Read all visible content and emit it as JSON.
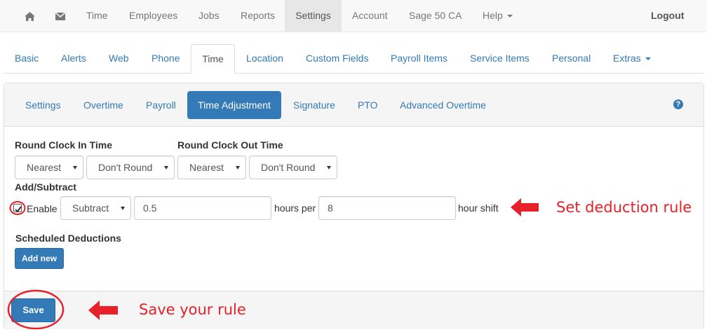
{
  "topnav": {
    "home_icon": "home-icon",
    "mail_icon": "envelope-icon",
    "items": [
      "Time",
      "Employees",
      "Jobs",
      "Reports",
      "Settings",
      "Account",
      "Sage 50 CA",
      "Help"
    ],
    "active": "Settings",
    "logout": "Logout"
  },
  "settings_tabs": {
    "items": [
      "Basic",
      "Alerts",
      "Web",
      "Phone",
      "Time",
      "Location",
      "Custom Fields",
      "Payroll Items",
      "Service Items",
      "Personal",
      "Extras"
    ],
    "active": "Time"
  },
  "time_tabs": {
    "items": [
      "Settings",
      "Overtime",
      "Payroll",
      "Time Adjustment",
      "Signature",
      "PTO",
      "Advanced Overtime"
    ],
    "active": "Time Adjustment",
    "help_icon": "?"
  },
  "form": {
    "round_in_label": "Round Clock In Time",
    "round_in_direction": "Nearest",
    "round_in_interval": "Don't Round",
    "round_out_label": "Round Clock Out Time",
    "round_out_direction": "Nearest",
    "round_out_interval": "Don't Round",
    "add_subtract_label": "Add/Subtract",
    "enable_label": "Enable",
    "enable_checked": true,
    "operation": "Subtract",
    "hours_value": "0.5",
    "hours_per_label": "hours per",
    "shift_value": "8",
    "hour_shift_label": "hour shift",
    "scheduled_label": "Scheduled Deductions",
    "add_new": "Add new"
  },
  "footer": {
    "save": "Save"
  },
  "annotations": {
    "deduction": "Set deduction rule",
    "save": "Save your rule",
    "color": "#e8202a"
  },
  "colors": {
    "primary": "#337ab7",
    "link": "#337ab7",
    "annotation": "#e8202a"
  }
}
